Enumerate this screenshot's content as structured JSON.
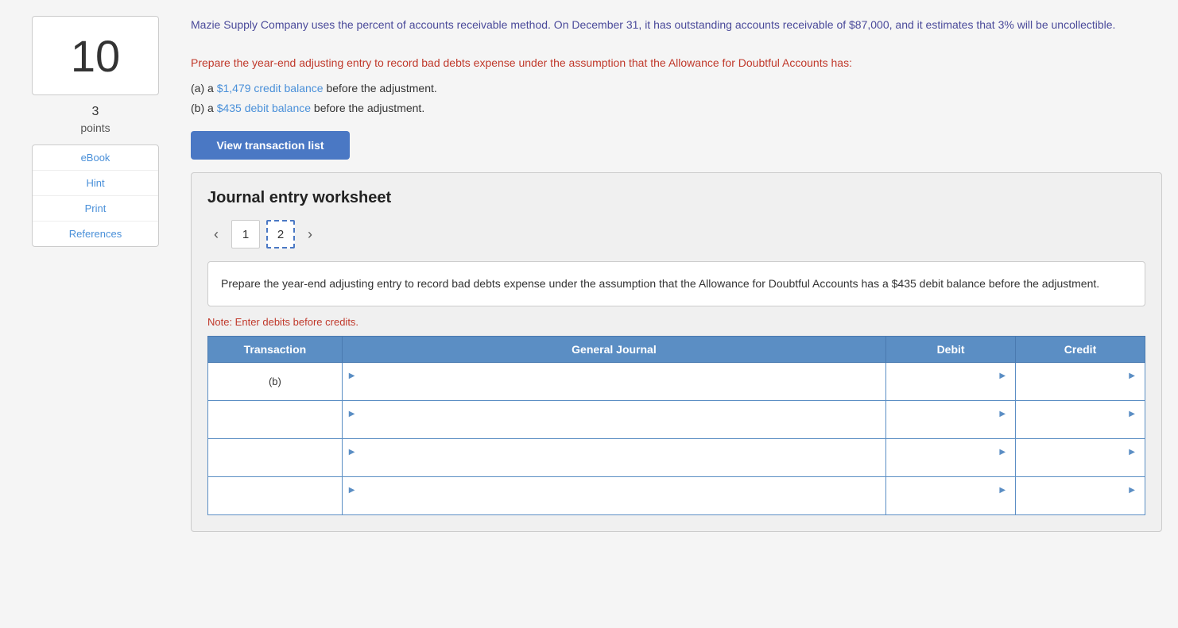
{
  "question": {
    "number": "10",
    "points": "3",
    "points_label": "points",
    "main_text": "Mazie Supply Company uses the percent of accounts receivable method. On December 31, it has outstanding accounts receivable of $87,000, and it estimates that 3% will be uncollectible.",
    "instruction_text": "Prepare the year-end adjusting entry to record bad debts expense under the assumption that the Allowance for Doubtful Accounts has:",
    "part_a_prefix": "(a) a ",
    "part_a_highlight": "$1,479 credit balance",
    "part_a_suffix": " before the adjustment.",
    "part_b_prefix": "(b) a ",
    "part_b_highlight": "$435 debit balance",
    "part_b_suffix": " before the adjustment."
  },
  "sidebar": {
    "ebook_label": "eBook",
    "hint_label": "Hint",
    "print_label": "Print",
    "references_label": "References"
  },
  "buttons": {
    "view_transaction_list": "View transaction list"
  },
  "worksheet": {
    "title": "Journal entry worksheet",
    "tab1_label": "1",
    "tab2_label": "2",
    "instruction_text": "Prepare the year-end adjusting entry to record bad debts expense under the assumption that the Allowance for Doubtful Accounts has a $435 debit balance before the adjustment.",
    "note_text": "Note: Enter debits before credits.",
    "table_headers": {
      "transaction": "Transaction",
      "general_journal": "General Journal",
      "debit": "Debit",
      "credit": "Credit"
    },
    "rows": [
      {
        "transaction": "(b)",
        "journal": "",
        "debit": "",
        "credit": ""
      },
      {
        "transaction": "",
        "journal": "",
        "debit": "",
        "credit": ""
      },
      {
        "transaction": "",
        "journal": "",
        "debit": "",
        "credit": ""
      },
      {
        "transaction": "",
        "journal": "",
        "debit": "",
        "credit": ""
      }
    ]
  },
  "icons": {
    "left_arrow": "‹",
    "right_arrow": "›"
  }
}
